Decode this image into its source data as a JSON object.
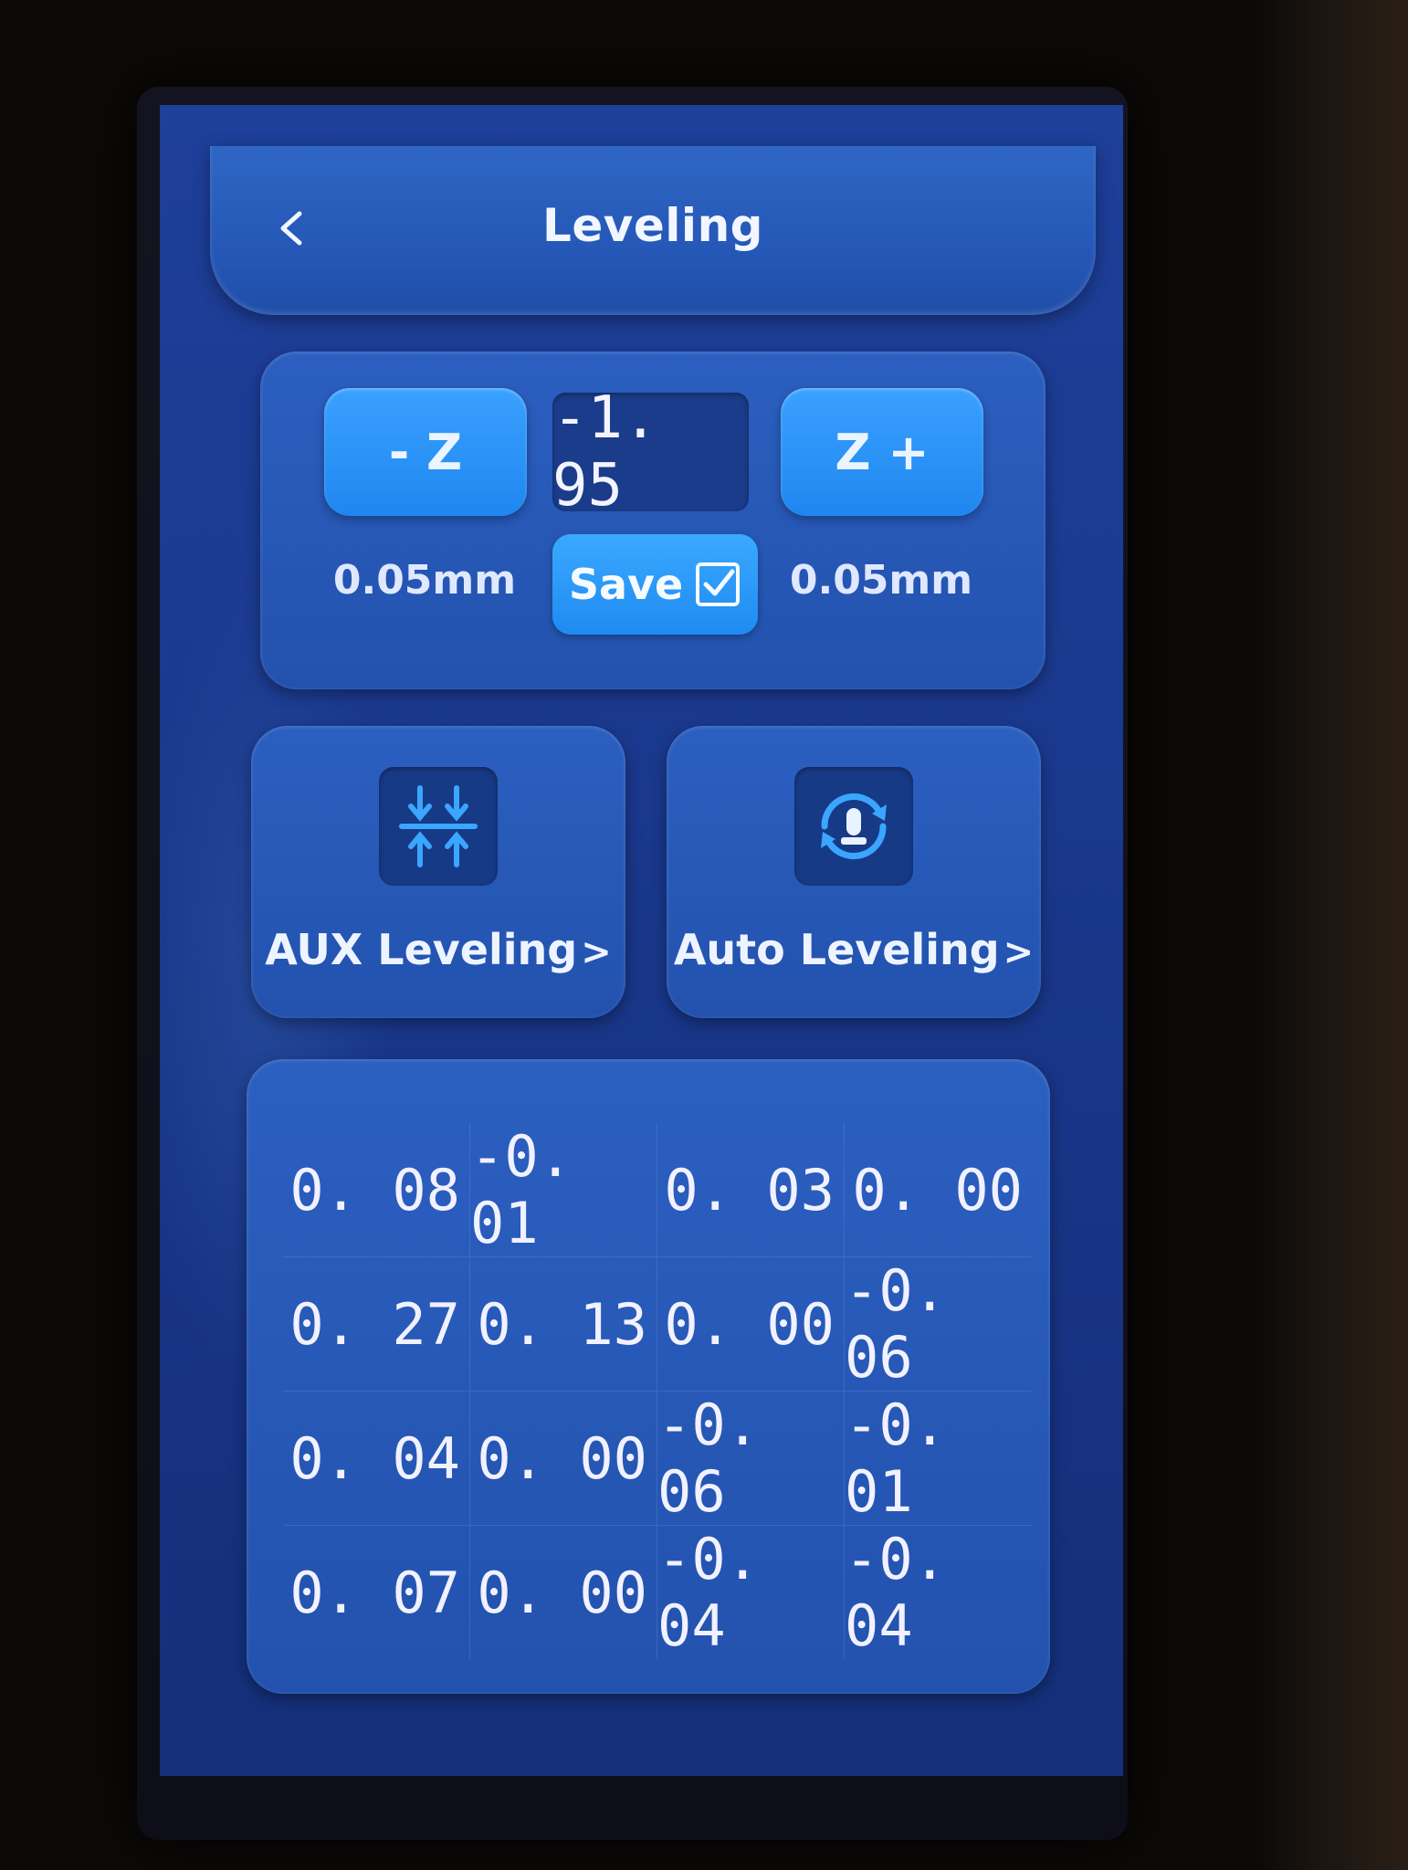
{
  "header": {
    "title": "Leveling",
    "back_icon": "chevron-left-icon"
  },
  "z_offset": {
    "minus_label": "- Z",
    "plus_label": "Z +",
    "value": "-1. 95",
    "step_left": "0.05mm",
    "step_right": "0.05mm",
    "save_label": "Save",
    "save_icon": "checkbox-check-icon"
  },
  "leveling_buttons": [
    {
      "label": "AUX Leveling",
      "chevron": ">",
      "icon": "aux-leveling-arrows-icon"
    },
    {
      "label": "Auto Leveling",
      "chevron": ">",
      "icon": "auto-leveling-cycle-icon"
    }
  ],
  "mesh": [
    [
      "0. 08",
      "-0. 01",
      "0. 03",
      "0. 00"
    ],
    [
      "0. 27",
      "0. 13",
      "0. 00",
      "-0. 06"
    ],
    [
      "0. 04",
      "0. 00",
      "-0. 06",
      "-0. 01"
    ],
    [
      "0. 07",
      "0. 00",
      "-0. 04",
      "-0. 04"
    ]
  ],
  "colors": {
    "screen_bg": "#1b3a90",
    "button_accent": "#2a94f8",
    "panel": "#2658b5",
    "text": "#f1f1ff"
  }
}
